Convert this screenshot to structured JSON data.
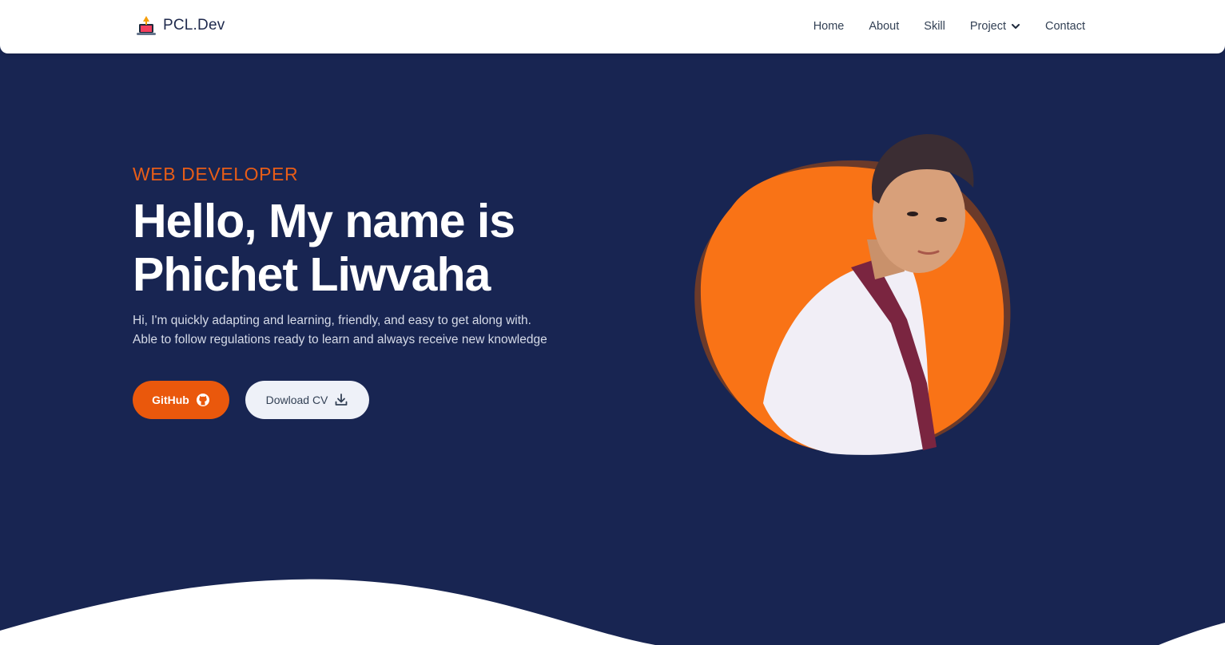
{
  "navbar": {
    "brand": "PCL.Dev",
    "links": [
      "Home",
      "About",
      "Skill",
      "Project",
      "Contact"
    ]
  },
  "hero": {
    "eyebrow": "WEB DEVELOPER",
    "title_line1": "Hello, My name is",
    "title_line2": "Phichet Liwvaha",
    "desc_line1": "Hi, I'm quickly adapting and learning, friendly, and easy to get along with.",
    "desc_line2": "Able to follow regulations ready to learn and always receive new knowledge",
    "github_label": "GitHub",
    "cv_label": "Dowload CV"
  },
  "colors": {
    "background": "#182552",
    "accent": "#ea580c",
    "blob": "#f97316",
    "navbar": "#ffffff"
  },
  "icons": {
    "brand": "laptop-logo-icon",
    "project_dropdown": "chevron-down-icon",
    "github": "github-icon",
    "download": "download-icon"
  }
}
